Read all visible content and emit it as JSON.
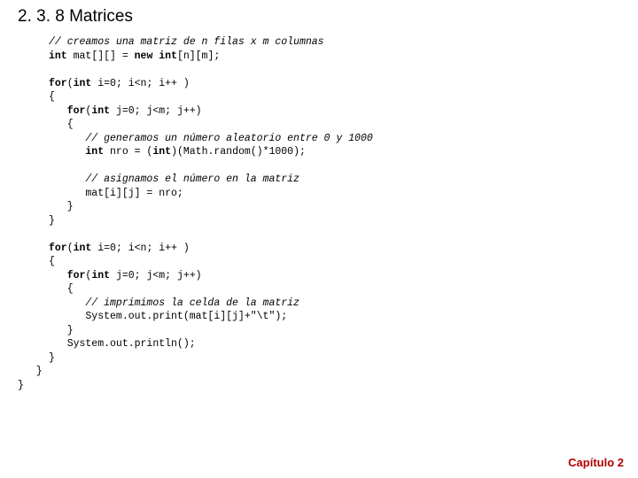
{
  "heading": "2. 3. 8 Matrices",
  "code": {
    "c1": "// creamos una matriz de n filas x m columnas",
    "c2a": "int",
    "c2b": " mat[][] = ",
    "c2c": "new int",
    "c2d": "[n][m];",
    "c3a": "for",
    "c3b": "(",
    "c3c": "int",
    "c3d": " i=0; i<n; i++ )",
    "c4": "{",
    "c5a": "   for",
    "c5b": "(",
    "c5c": "int",
    "c5d": " j=0; j<m; j++)",
    "c6": "   {",
    "c7": "      // generamos un número aleatorio entre 0 y 1000",
    "c8a": "      int",
    "c8b": " nro = (",
    "c8c": "int",
    "c8d": ")(Math.random()*1000);",
    "c9": "      // asignamos el número en la matriz",
    "c10": "      mat[i][j] = nro;",
    "c11": "   }",
    "c12": "}",
    "c13a": "for",
    "c13b": "(",
    "c13c": "int",
    "c13d": " i=0; i<n; i++ )",
    "c14": "{",
    "c15a": "   for",
    "c15b": "(",
    "c15c": "int",
    "c15d": " j=0; j<m; j++)",
    "c16": "   {",
    "c17": "      // imprimimos la celda de la matriz",
    "c18": "      System.out.print(mat[i][j]+\"\\t\");",
    "c19": "   }",
    "c20": "   System.out.println();",
    "c21": "}",
    "c22": "   }",
    "c23": "}"
  },
  "footer": "Capítulo 2"
}
